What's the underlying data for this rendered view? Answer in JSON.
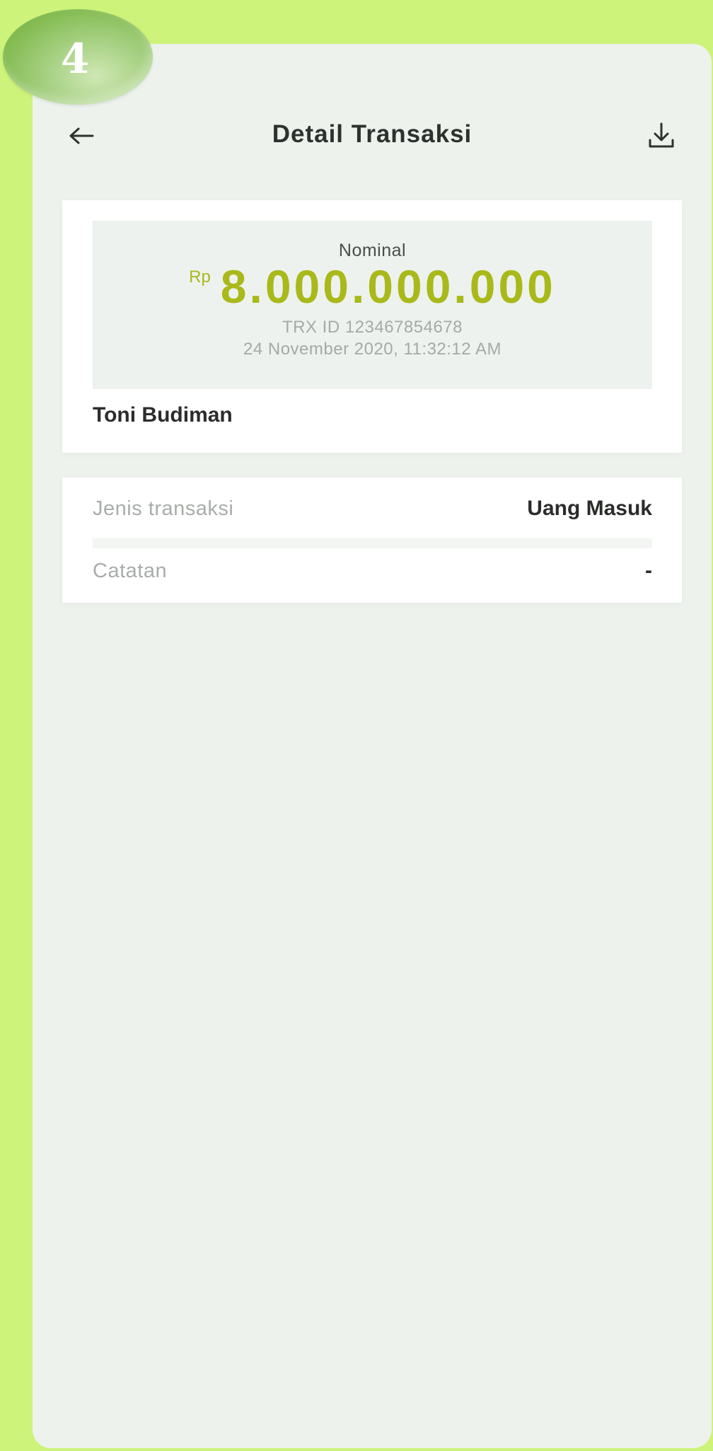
{
  "badge": {
    "number": "4"
  },
  "header": {
    "title": "Detail Transaksi",
    "back_icon": "arrow-left-icon",
    "download_icon": "download-icon"
  },
  "summary": {
    "nominal_label": "Nominal",
    "currency": "Rp",
    "amount": "8.000.000.000",
    "trx_id": "TRX ID 123467854678",
    "datetime": "24 November 2020, 11:32:12 AM",
    "name": "Toni Budiman"
  },
  "details": {
    "rows": [
      {
        "label": "Jenis transaksi",
        "value": "Uang Masuk"
      },
      {
        "label": "Catatan",
        "value": "-"
      }
    ]
  },
  "colors": {
    "background": "#cdf37a",
    "panel": "#edf2ed",
    "amount": "#a9b91a",
    "badge": "#86bd55"
  }
}
